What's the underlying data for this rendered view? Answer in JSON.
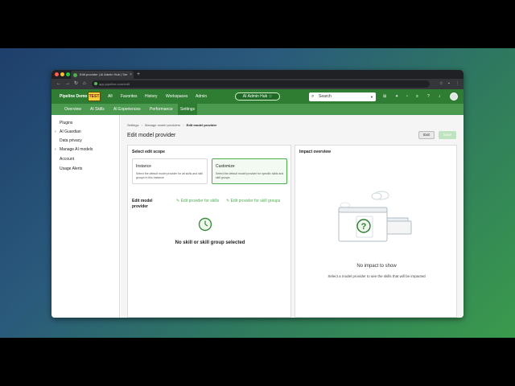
{
  "browser": {
    "tab_title": "Edit provider | AI Admin Hub | Ser",
    "tab_close": "×",
    "new_tab": "+",
    "url": "app.pipeline.com/edit",
    "nav": {
      "back": "←",
      "forward": "→",
      "reload": "↻",
      "home": "⌂"
    }
  },
  "app": {
    "brand": "Pipeline Demo",
    "logo_text": "TEST",
    "top_nav": [
      "All",
      "Favorites",
      "History",
      "Workspaces",
      "Admin"
    ],
    "hub_label": "AI Admin Hub",
    "search_placeholder": "Search",
    "sub_nav": [
      "Overview",
      "AI Skills",
      "AI Experiences",
      "Performance",
      "Settings"
    ],
    "active_sub_nav": "Settings"
  },
  "sidebar": {
    "items": [
      "Plugins",
      "AI Guardian",
      "Data privacy",
      "Manage AI models",
      "Account",
      "Usage Alerts"
    ]
  },
  "page": {
    "breadcrumbs": [
      "Settings",
      "Manage model providers",
      "Edit model provider"
    ],
    "title": "Edit model provider",
    "exit_label": "Exit",
    "save_label": "Save"
  },
  "edit_scope": {
    "heading": "Select edit scope",
    "cards": [
      {
        "title": "Instance",
        "desc": "Select the default model provider for all skills and skill groups in this instance"
      },
      {
        "title": "Customize",
        "desc": "Select the default model provider for specific skills and skill groups"
      }
    ],
    "selected": "Customize",
    "edit_label": "Edit model provider",
    "link_skills": "Edit provider for skills",
    "link_groups": "Edit provider for skill groups",
    "empty_text": "No skill or skill group selected"
  },
  "impact": {
    "heading": "Impact overview",
    "empty_title": "No impact to show",
    "empty_desc": "Select a model provider to see the skills that will be impacted"
  },
  "colors": {
    "brand_green": "#2e7d32",
    "subnav_green": "#4b9a4f",
    "link_green": "#4caf50",
    "logo_yellow": "#f2cf3c"
  },
  "icons": [
    "search-icon",
    "clock-icon",
    "question-icon",
    "cloud-icon",
    "sparkle-icon",
    "bell-icon",
    "help-icon",
    "grid-icon"
  ]
}
